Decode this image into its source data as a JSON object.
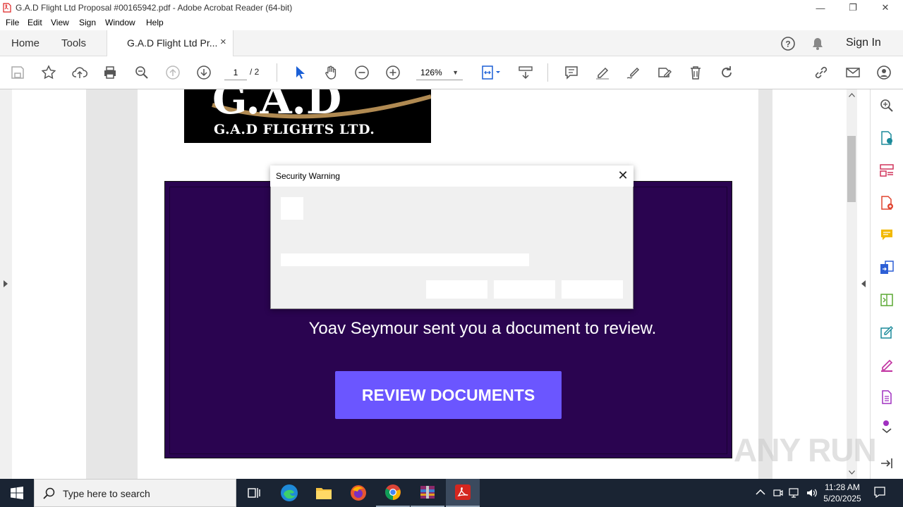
{
  "window": {
    "title": "G.A.D Flight Ltd Proposal #00165942.pdf - Adobe Acrobat Reader (64-bit)",
    "minimize": "—",
    "restore": "❐",
    "close": "✕"
  },
  "menu": [
    "File",
    "Edit",
    "View",
    "Sign",
    "Window",
    "Help"
  ],
  "tabs": {
    "home": "Home",
    "tools": "Tools",
    "document": "G.A.D Flight Ltd Pr...",
    "document_close": "×",
    "sign_in": "Sign In"
  },
  "toolbar": {
    "page_current": "1",
    "page_total": "/  2",
    "zoom": "126%",
    "zoom_caret": "▼"
  },
  "document": {
    "logo_text": "G.A.D FLIGHTS LTD.",
    "sent_message": "Yoav Seymour sent you a document to review.",
    "review_button": "REVIEW DOCUMENTS"
  },
  "dialog": {
    "title": "Security Warning",
    "close": "✕"
  },
  "taskbar": {
    "search_placeholder": "Type here to search",
    "time": "11:28 AM",
    "date": "5/20/2025"
  },
  "watermark": "ANY RUN",
  "colors": {
    "email_bg": "#2a0450",
    "review_button": "#6b56ff",
    "taskbar": "#1a2433"
  }
}
